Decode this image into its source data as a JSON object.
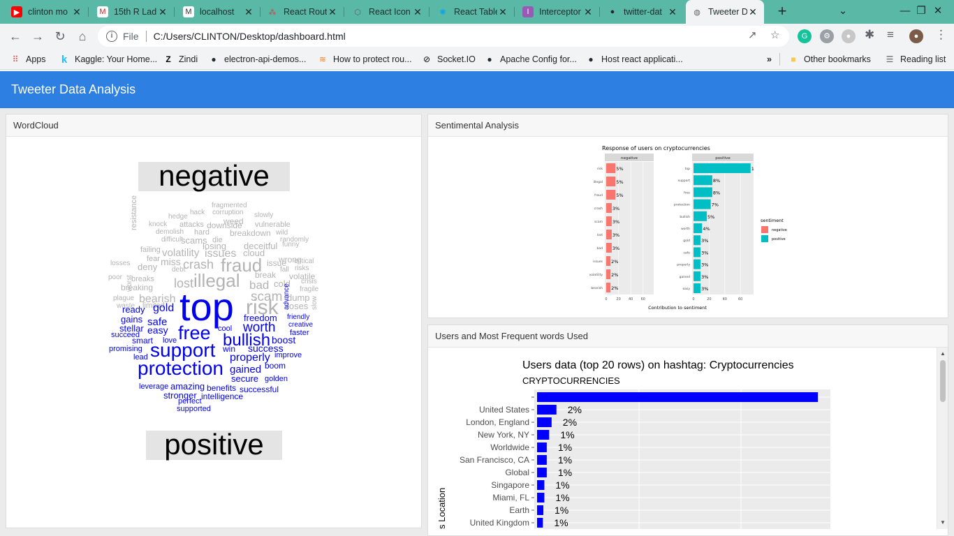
{
  "browser": {
    "tabs": [
      {
        "title": "clinton mo",
        "icon": "youtube-icon"
      },
      {
        "title": "15th R Lad",
        "icon": "gmail-icon"
      },
      {
        "title": "localhost",
        "icon": "localhost-icon"
      },
      {
        "title": "React Rout",
        "icon": "react-router-icon"
      },
      {
        "title": "React Icon",
        "icon": "react-icons-icon"
      },
      {
        "title": "React Table",
        "icon": "react-table-icon"
      },
      {
        "title": "Interceptor",
        "icon": "interceptor-icon"
      },
      {
        "title": "twitter-dat",
        "icon": "github-icon"
      },
      {
        "title": "Tweeter D",
        "icon": "globe-icon"
      }
    ],
    "url_scheme_label": "File",
    "url": "C:/Users/CLINTON/Desktop/dashboard.html",
    "bookmarks": [
      {
        "label": "Apps",
        "icon": "apps-grid-icon"
      },
      {
        "label": "Kaggle: Your Home...",
        "icon": "kaggle-icon"
      },
      {
        "label": "Zindi",
        "icon": "zindi-icon"
      },
      {
        "label": "electron-api-demos...",
        "icon": "github-icon"
      },
      {
        "label": "How to protect rou...",
        "icon": "stackoverflow-icon"
      },
      {
        "label": "Socket.IO",
        "icon": "socketio-icon"
      },
      {
        "label": "Apache Config for...",
        "icon": "github-icon"
      },
      {
        "label": "Host react applicati...",
        "icon": "github-icon"
      }
    ],
    "bookmarks_overflow": "»",
    "other_bookmarks": "Other bookmarks",
    "reading_list": "Reading list"
  },
  "app": {
    "title": "Tweeter Data Analysis",
    "panels": {
      "wordcloud": "WordCloud",
      "sentiment": "Sentimental Analysis",
      "users": "Users and Most Frequent words Used"
    }
  },
  "wordcloud": {
    "negative_label": "negative",
    "positive_label": "positive",
    "negative_words": [
      "fragmented",
      "hack",
      "corruption",
      "hedge",
      "slowly",
      "weed",
      "knock",
      "attacks",
      "downside",
      "vulnerable",
      "demolish",
      "hard",
      "breakdown",
      "wild",
      "difficult",
      "scams",
      "die",
      "randomly",
      "losing",
      "deceitful",
      "funny",
      "failing",
      "resistance",
      "volatility",
      "issues",
      "cloud",
      "fear",
      "wrong",
      "losses",
      "deny",
      "miss",
      "crash",
      "fraud",
      "issue",
      "critical",
      "debt",
      "fall",
      "risks",
      "poor",
      "worst",
      "break",
      "volatile",
      "breaks",
      "lost",
      "illegal",
      "bad",
      "cold",
      "crisis",
      "breaking",
      "fragile",
      "scam",
      "dump",
      "plague",
      "bearish",
      "risk",
      "loses",
      "waste",
      "limited",
      "slow"
    ],
    "positive_words": [
      "top",
      "ready",
      "gold",
      "freedom",
      "friendly",
      "gains",
      "safe",
      "creative",
      "stellar",
      "easy",
      "cool",
      "worth",
      "faster",
      "succeed",
      "free",
      "bullish",
      "boost",
      "smart",
      "love",
      "win",
      "success",
      "promising",
      "support",
      "properly",
      "improve",
      "lead",
      "protection",
      "gained",
      "boom",
      "secure",
      "golden",
      "leverage",
      "amazing",
      "benefits",
      "successful",
      "stronger",
      "intelligence",
      "perfect",
      "supported",
      "advance"
    ]
  },
  "sentiment_chart": {
    "title": "Response of users on cryptocurrencies",
    "facets": [
      "negative",
      "positive"
    ],
    "xlabel": "Contribution to sentiment",
    "x_ticks": [
      "0",
      "20",
      "40",
      "60"
    ],
    "legend_title": "sentiment",
    "legend_items": [
      "negative",
      "positive"
    ],
    "colors": {
      "negative": "#f8766d",
      "positive": "#00bfc4"
    }
  },
  "users_chart": {
    "title": "Users data (top 20 rows) on hashtag: Cryptocurrencies",
    "subtitle": "CRYPTOCURRENCIES",
    "ylabel": "s Location",
    "bar_color": "#0000ff"
  },
  "chart_data": [
    {
      "type": "bar",
      "title": "Response of users on cryptocurrencies",
      "xlabel": "Contribution to sentiment",
      "xlim": [
        0,
        75
      ],
      "series": [
        {
          "name": "negative",
          "categories": [
            "risk",
            "illegal",
            "fraud",
            "crash",
            "scam",
            "lost",
            "bad",
            "issues",
            "volatility",
            "bearish"
          ],
          "values": [
            15,
            15,
            15,
            9,
            9,
            9,
            9,
            7,
            7,
            7
          ],
          "labels": [
            "5%",
            "5%",
            "5%",
            "3%",
            "3%",
            "3%",
            "3%",
            "2%",
            "2%",
            "2%"
          ]
        },
        {
          "name": "positive",
          "categories": [
            "top",
            "support",
            "free",
            "protection",
            "bullish",
            "worth",
            "gold",
            "safe",
            "properly",
            "gained",
            "easy"
          ],
          "values": [
            73,
            24,
            24,
            22,
            17,
            11,
            9,
            9,
            9,
            9,
            9
          ],
          "labels": [
            "1",
            "8%",
            "8%",
            "7%",
            "5%",
            "4%",
            "3%",
            "3%",
            "3%",
            "3%",
            "3%"
          ]
        }
      ]
    },
    {
      "type": "bar",
      "title": "Users data (top 20 rows) on hashtag: Cryptocurrencies",
      "subtitle": "CRYPTOCURRENCIES",
      "ylabel": "s Location",
      "categories": [
        "",
        "United States",
        "London, England",
        "New York, NY",
        "Worldwide",
        "San Francisco, CA",
        "Global",
        "Singapore",
        "Miami, FL",
        "Earth",
        "United Kingdom"
      ],
      "values": [
        58,
        4,
        3,
        2.5,
        2,
        2,
        2,
        1.5,
        1.5,
        1.3,
        1.2
      ],
      "labels": [
        "",
        "2%",
        "2%",
        "1%",
        "1%",
        "1%",
        "1%",
        "1%",
        "1%",
        "1%",
        "1%"
      ]
    }
  ]
}
